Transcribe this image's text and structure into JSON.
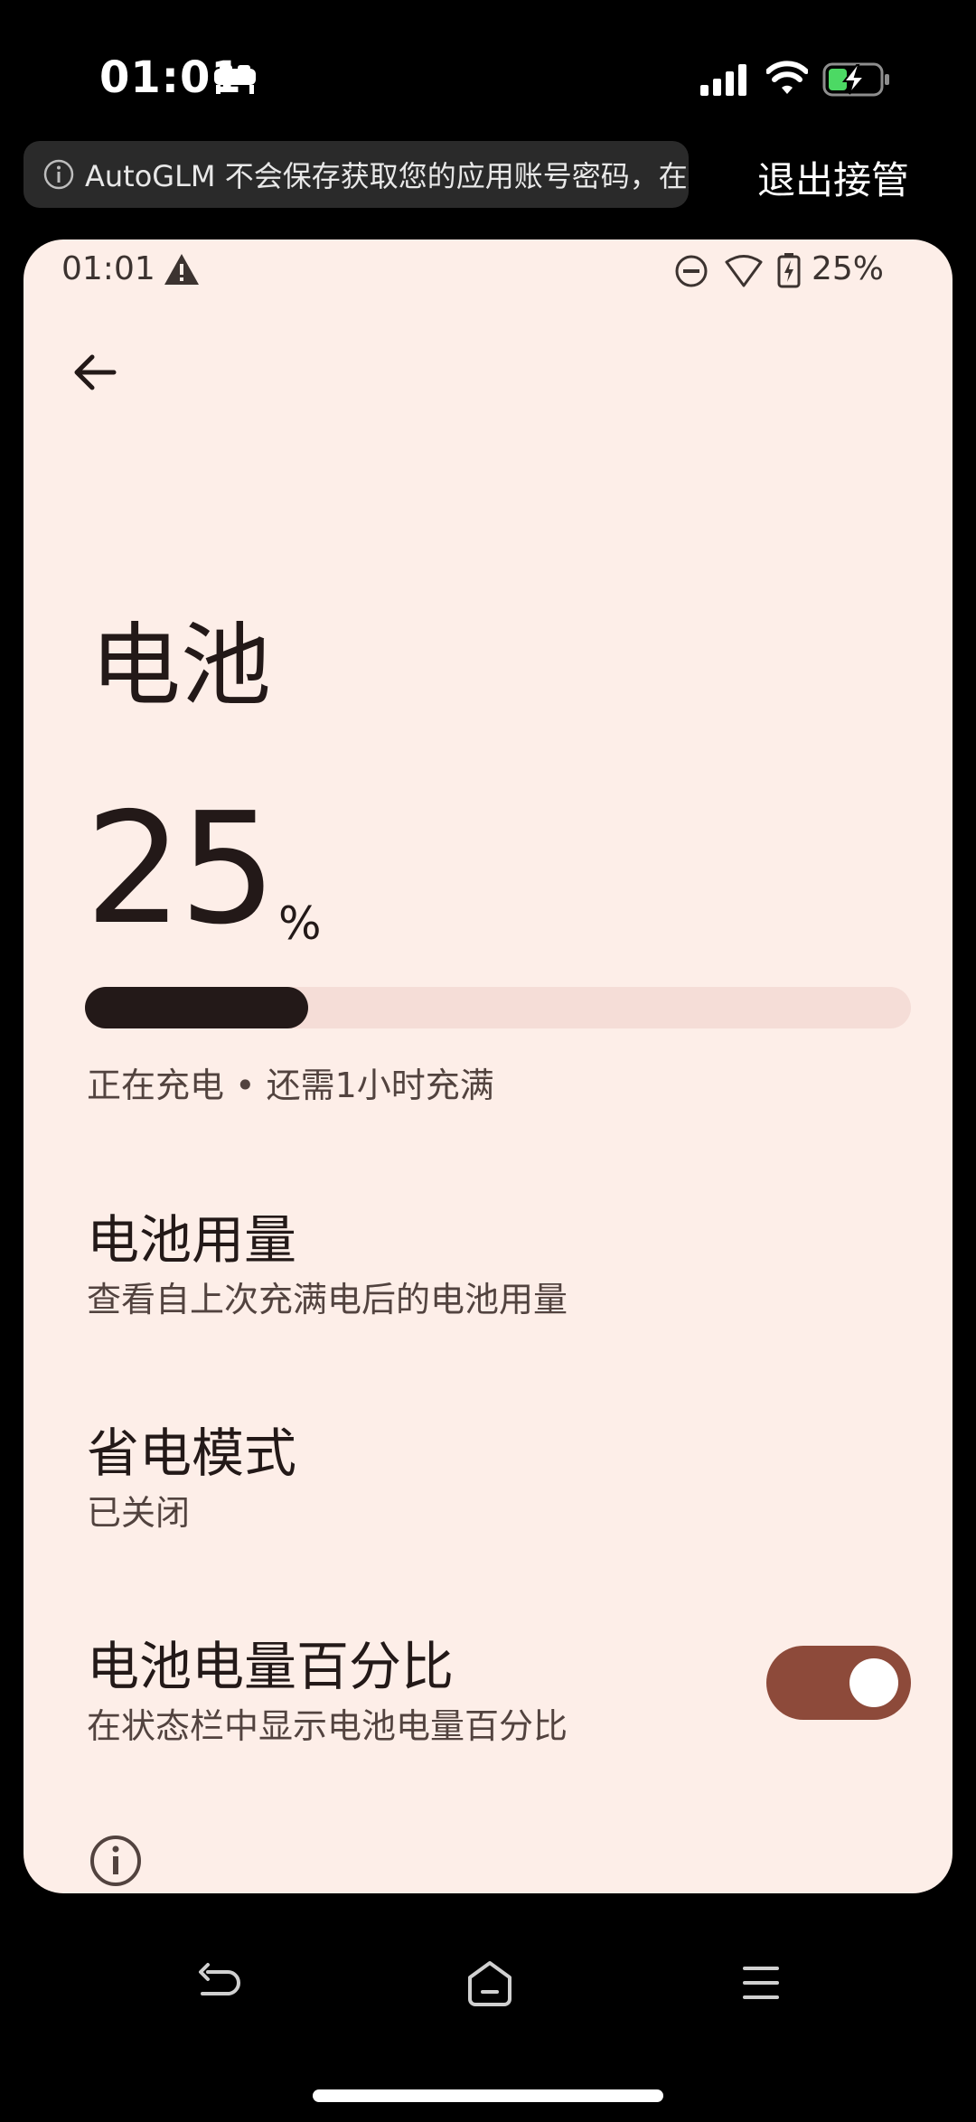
{
  "ios_status": {
    "time": "01:01"
  },
  "overlay": {
    "notice_text": "AutoGLM 不会保存获取您的应用账号密码，在用",
    "exit_label": "退出接管"
  },
  "android_status": {
    "time": "01:01",
    "battery_text": "25%"
  },
  "page": {
    "title": "电池",
    "battery_percent": "25",
    "percent_sign": "%",
    "battery_level": 0.27,
    "charge_status": "正在充电 • 还需1小时充满"
  },
  "settings": [
    {
      "title": "电池用量",
      "subtitle": "查看自上次充满电后的电池用量"
    },
    {
      "title": "省电模式",
      "subtitle": "已关闭"
    },
    {
      "title": "电池电量百分比",
      "subtitle": "在状态栏中显示电池电量百分比",
      "toggle_on": true
    }
  ],
  "colors": {
    "screen_bg": "#fdeee8",
    "text_primary": "#231918",
    "text_secondary": "#52433f",
    "bar_track": "#f5ddd7",
    "toggle_on": "#8d4a3a"
  },
  "icons": [
    "bed-icon",
    "signal-icon",
    "wifi-icon",
    "battery-charging-icon",
    "info-icon",
    "warning-icon",
    "dnd-icon",
    "back-arrow-icon",
    "nav-back-icon",
    "nav-home-icon",
    "nav-menu-icon"
  ]
}
